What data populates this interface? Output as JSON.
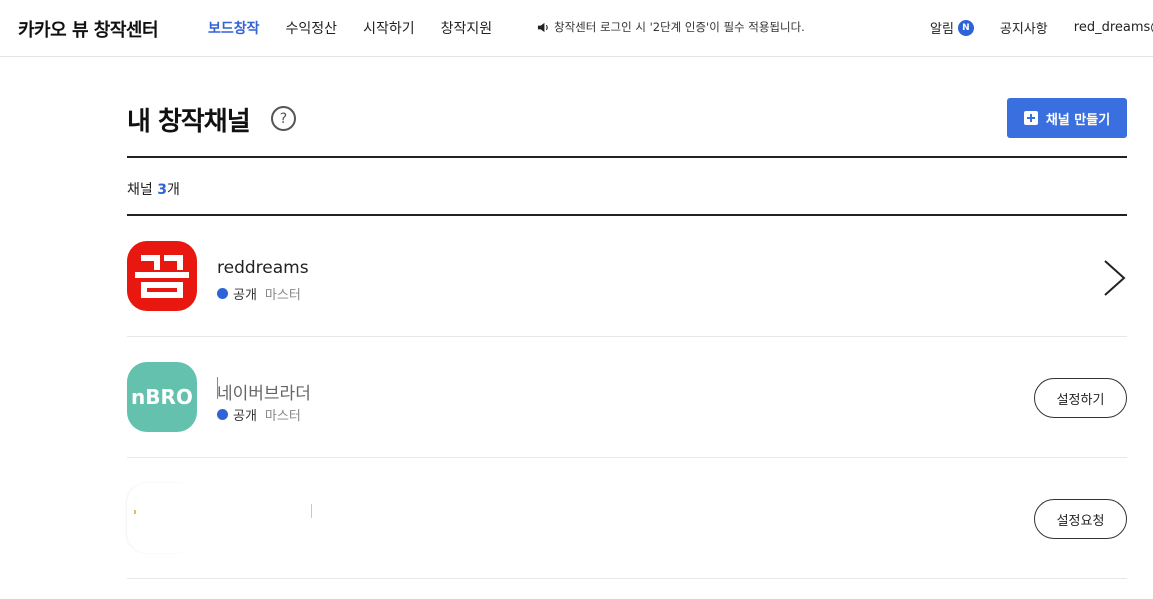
{
  "header": {
    "logo": "카카오 뷰 창작센터",
    "nav": [
      "보드창작",
      "수익정산",
      "시작하기",
      "창작지원"
    ],
    "notice": "창작센터 로그인 시 '2단계 인증'이 필수 적용됩니다.",
    "alarm_label": "알림",
    "alarm_badge": "N",
    "notice_link": "공지사항",
    "user_id": "red_dreams@"
  },
  "main": {
    "title": "내 창작채널",
    "help_symbol": "?",
    "create_button": "채널 만들기",
    "count_prefix": "채널 ",
    "count_value": "3",
    "count_suffix": "개"
  },
  "channels": [
    {
      "name": "reddreams",
      "avatar_text": "꿈",
      "status": "공개",
      "role": "마스터",
      "action": "chevron-right"
    },
    {
      "name": "네이버브라더",
      "avatar_text": "nBRO",
      "status": "공개",
      "role": "마스터",
      "action_label": "설정하기"
    },
    {
      "name": "",
      "action_label": "설정요청"
    }
  ],
  "colors": {
    "accent": "#3a6fe0",
    "active_nav": "#3463d8",
    "avatar_red": "#e8170f",
    "avatar_teal": "#64c1ad"
  },
  "icons": {
    "notice": "speaker-icon",
    "help": "question-icon",
    "create": "plus-square-icon",
    "row_action": "chevron-right-icon"
  }
}
